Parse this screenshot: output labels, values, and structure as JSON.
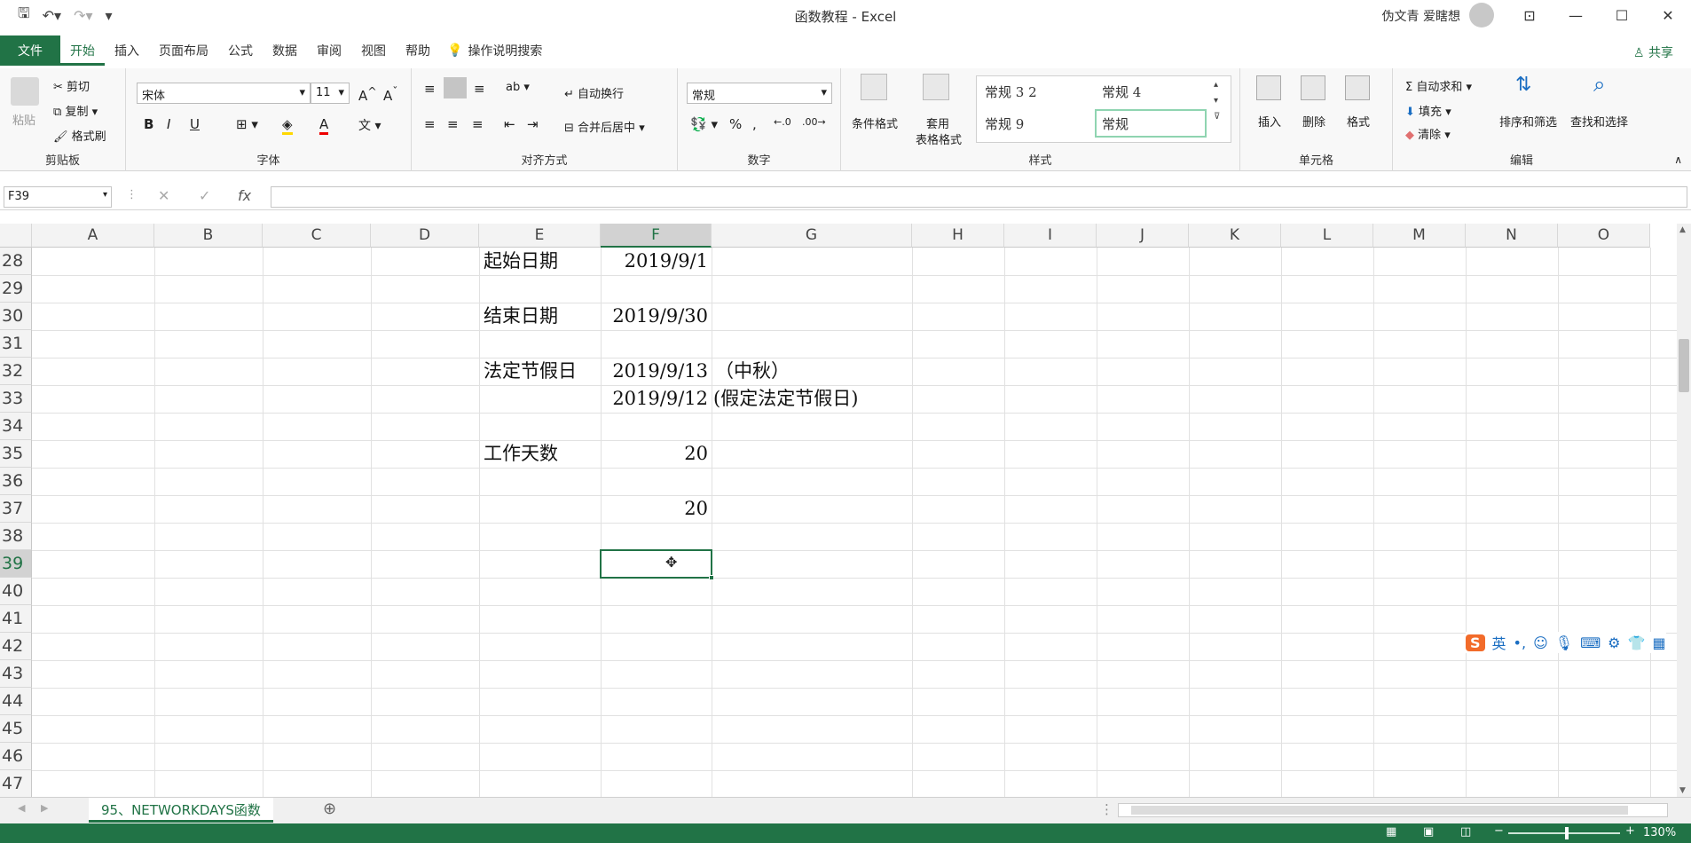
{
  "window": {
    "title": "函数教程  -  Excel",
    "user": "伪文青 爱瞎想"
  },
  "tabs": [
    "文件",
    "开始",
    "插入",
    "页面布局",
    "公式",
    "数据",
    "审阅",
    "视图",
    "帮助"
  ],
  "tellme": "操作说明搜索",
  "share": "共享",
  "ribbon": {
    "clipboard": {
      "paste": "粘贴",
      "cut": "剪切",
      "copy": "复制",
      "painter": "格式刷",
      "label": "剪贴板"
    },
    "font": {
      "name": "宋体",
      "size": "11",
      "label": "字体",
      "bold": "B",
      "italic": "I",
      "underline": "U"
    },
    "align": {
      "wrap": "自动换行",
      "merge": "合并后居中",
      "label": "对齐方式"
    },
    "number": {
      "format": "常规",
      "label": "数字"
    },
    "styles": {
      "cond": "条件格式",
      "table1": "套用",
      "table2": "表格格式",
      "s1": "常规 3 2",
      "s2": "常规 4",
      "s3": "常规 9",
      "s4": "常规",
      "label": "样式"
    },
    "cells": {
      "insert": "插入",
      "delete": "删除",
      "format": "格式",
      "label": "单元格"
    },
    "edit": {
      "sum": "自动求和",
      "fill": "填充",
      "clear": "清除",
      "sort": "排序和筛选",
      "find": "查找和选择",
      "label": "编辑"
    }
  },
  "namebox": "F39",
  "columns": [
    "A",
    "B",
    "C",
    "D",
    "E",
    "F",
    "G",
    "H",
    "I",
    "J",
    "K",
    "L",
    "M",
    "N",
    "O"
  ],
  "rows": [
    "28",
    "29",
    "30",
    "31",
    "32",
    "33",
    "34",
    "35",
    "36",
    "37",
    "38",
    "39",
    "40",
    "41",
    "42",
    "43",
    "44",
    "45",
    "46",
    "47"
  ],
  "cells": {
    "e28": "起始日期",
    "f28": "2019/9/1",
    "e30": "结束日期",
    "f30": "2019/9/30",
    "e32": "法定节假日",
    "f32": "2019/9/13",
    "g32": "（中秋）",
    "f33": "2019/9/12",
    "g33": "(假定法定节假日)",
    "e35": "工作天数",
    "f35": "20",
    "f37": "20"
  },
  "sheet_tab": "95、NETWORKDAYS函数",
  "zoom": "130%",
  "ime": "英"
}
